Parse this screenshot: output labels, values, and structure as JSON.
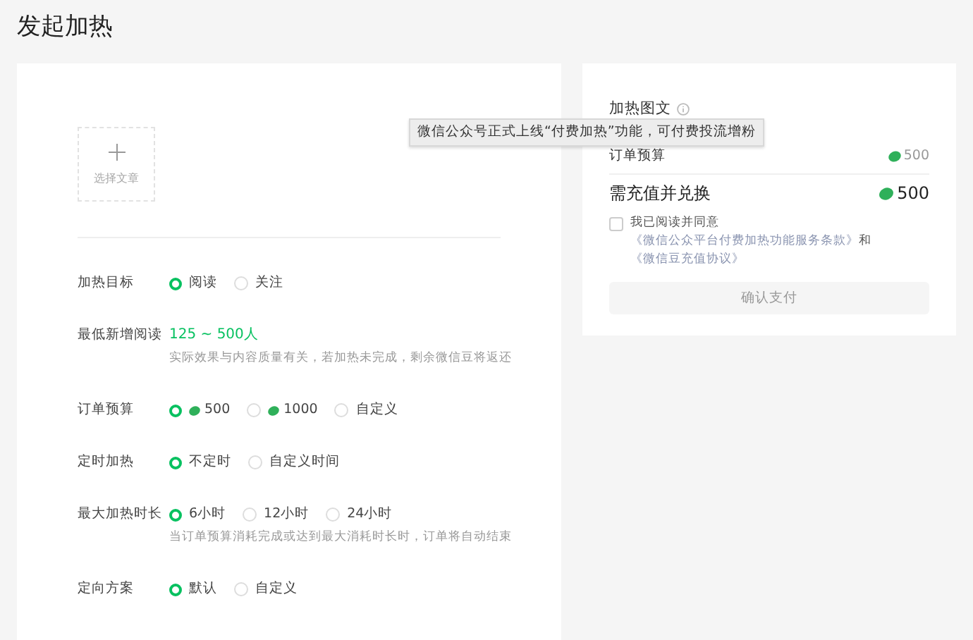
{
  "title": "发起加热",
  "upload": {
    "label": "选择文章"
  },
  "form": [
    {
      "label": "加热目标",
      "kind": "radio",
      "options": [
        {
          "label": "阅读",
          "bean": false,
          "selected": true
        },
        {
          "label": "关注",
          "bean": false,
          "selected": false
        }
      ]
    },
    {
      "label": "最低新增阅读",
      "kind": "text",
      "value": "125 ~ 500人",
      "hint": "实际效果与内容质量有关，若加热未完成，剩余微信豆将返还"
    },
    {
      "label": "订单预算",
      "kind": "radio",
      "options": [
        {
          "label": "500",
          "bean": true,
          "selected": true
        },
        {
          "label": "1000",
          "bean": true,
          "selected": false
        },
        {
          "label": "自定义",
          "bean": false,
          "selected": false
        }
      ]
    },
    {
      "label": "定时加热",
      "kind": "radio",
      "options": [
        {
          "label": "不定时",
          "bean": false,
          "selected": true
        },
        {
          "label": "自定义时间",
          "bean": false,
          "selected": false
        }
      ]
    },
    {
      "label": "最大加热时长",
      "kind": "radio",
      "options": [
        {
          "label": "6小时",
          "bean": false,
          "selected": true
        },
        {
          "label": "12小时",
          "bean": false,
          "selected": false
        },
        {
          "label": "24小时",
          "bean": false,
          "selected": false
        }
      ],
      "hint": "当订单预算消耗完成或达到最大消耗时长时，订单将自动结束"
    },
    {
      "label": "定向方案",
      "kind": "radio",
      "options": [
        {
          "label": "默认",
          "bean": false,
          "selected": true
        },
        {
          "label": "自定义",
          "bean": false,
          "selected": false
        }
      ]
    }
  ],
  "summary": {
    "heading": "加热图文",
    "budget": {
      "label": "订单预算",
      "amount": "500"
    },
    "total": {
      "label": "需充值并兑换",
      "amount": "500"
    },
    "agreement": {
      "checked": false,
      "parts": [
        {
          "text": "我已阅读并同意",
          "link": false
        },
        {
          "text": "《微信公众平台付费加热功能服务条款》",
          "link": true
        },
        {
          "text": "和",
          "link": false
        },
        {
          "text": "《微信豆充值协议》",
          "link": true
        }
      ]
    },
    "button": {
      "label": "确认支付",
      "disabled": true
    }
  },
  "tooltip": {
    "text": "微信公众号正式上线“付费加热”功能，可付费投流增粉"
  }
}
